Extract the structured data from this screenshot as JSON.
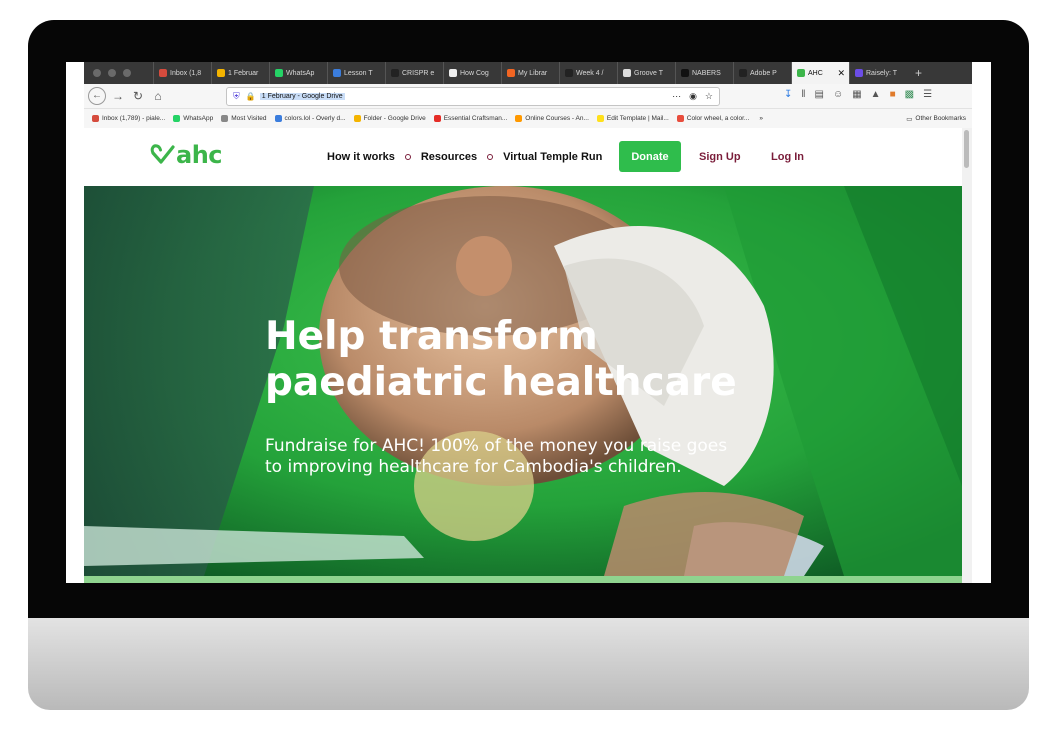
{
  "browser": {
    "tabs": [
      {
        "label": "Inbox (1,8",
        "color": "#d54b3d",
        "active": false
      },
      {
        "label": "1 Februar",
        "color": "#f4b400",
        "active": false
      },
      {
        "label": "WhatsAp",
        "color": "#25d366",
        "active": false
      },
      {
        "label": "Lesson T",
        "color": "#3b7ddd",
        "active": false
      },
      {
        "label": "CRISPR e",
        "color": "#222222",
        "active": false
      },
      {
        "label": "How Cog",
        "color": "#eeeeee",
        "active": false
      },
      {
        "label": "My Librar",
        "color": "#f26522",
        "active": false
      },
      {
        "label": "Week 4 /",
        "color": "#222222",
        "active": false
      },
      {
        "label": "Groove T",
        "color": "#dddddd",
        "active": false
      },
      {
        "label": "NABERS",
        "color": "#111111",
        "active": false
      },
      {
        "label": "Adobe P",
        "color": "#222222",
        "active": false
      },
      {
        "label": "AHC",
        "color": "#3cb54a",
        "active": true
      },
      {
        "label": "Raisely: T",
        "color": "#6b4de6",
        "active": false
      }
    ],
    "url": "1 February - Google Drive",
    "bookmarks": [
      {
        "label": "Inbox (1,789) - piale...",
        "color": "#d54b3d"
      },
      {
        "label": "WhatsApp",
        "color": "#25d366"
      },
      {
        "label": "Most Visited",
        "color": "#888888"
      },
      {
        "label": "colors.lol - Overly d...",
        "color": "#3b7ddd"
      },
      {
        "label": "Folder - Google Drive",
        "color": "#f4b400"
      },
      {
        "label": "Essential Craftsman...",
        "color": "#e52d27"
      },
      {
        "label": "Online Courses - An...",
        "color": "#ff9900"
      },
      {
        "label": "Edit Template | Mail...",
        "color": "#ffe01b"
      },
      {
        "label": "Color wheel, a color...",
        "color": "#e84d3d"
      }
    ],
    "other_bookmarks": "Other Bookmarks"
  },
  "site": {
    "logo": "ahc",
    "nav": [
      "How it works",
      "Resources",
      "Virtual Temple Run"
    ],
    "donate": "Donate",
    "signup": "Sign Up",
    "login": "Log In"
  },
  "hero": {
    "title_line1": "Help transform",
    "title_line2": "paediatric healthcare",
    "subtitle_line1": "Fundraise for AHC! 100% of the money you raise goes",
    "subtitle_line2": "to improving healthcare for Cambodia's children."
  },
  "colors": {
    "brand_green": "#3cb54a",
    "donate_green": "#2fbd4c",
    "maroon": "#7a1d3a"
  }
}
